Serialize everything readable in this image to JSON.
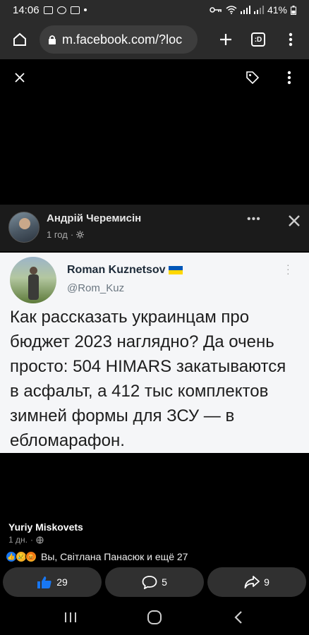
{
  "status_bar": {
    "time": "14:06",
    "battery": "41%"
  },
  "browser": {
    "url": "m.facebook.com/?loc",
    "tab_count": ":D"
  },
  "post": {
    "author": "Андрій Черемисін",
    "time": "1 год",
    "tweet": {
      "name": "Roman Kuznetsov",
      "handle": "@Rom_Kuz",
      "text": "Как рассказать украинцам про бюджет 2023 наглядно? Да очень просто: 504 HIMARS закатываются в асфальт, а 412 тыс комплектов зимней формы для ЗСУ — в ебломарафон."
    }
  },
  "caption": {
    "name": "Yuriy Miskovets",
    "time": "1 дн."
  },
  "reactions": {
    "summary": "Вы, Світлана Панасюк и ещё 27"
  },
  "actions": {
    "likes": "29",
    "comments": "5",
    "shares": "9"
  },
  "colors": {
    "ukraine_blue": "#0057b7",
    "ukraine_yellow": "#ffd700",
    "like_blue": "#1877f2"
  }
}
